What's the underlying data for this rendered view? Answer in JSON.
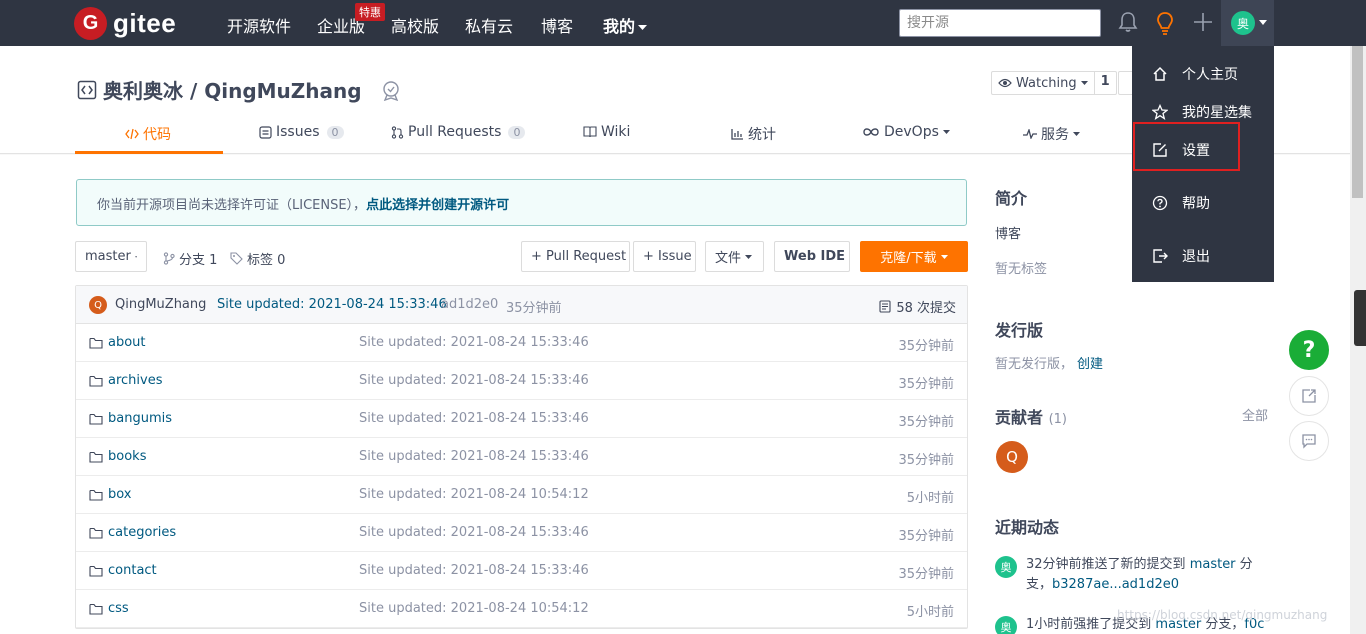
{
  "topnav": {
    "logo_letter": "G",
    "logo_text": "gitee",
    "items": [
      "开源软件",
      "企业版",
      "高校版",
      "私有云",
      "博客",
      "我的"
    ],
    "enterprise_badge": "特惠",
    "search_placeholder": "搜开源",
    "avatar_letter": "奥"
  },
  "repo": {
    "title": "奥利奥冰 / QingMuZhang",
    "watch_label": "Watching",
    "watch_count": "1",
    "tabs": [
      {
        "label": "代码",
        "count": ""
      },
      {
        "label": "Issues",
        "count": "0"
      },
      {
        "label": "Pull Requests",
        "count": "0"
      },
      {
        "label": "Wiki",
        "count": ""
      },
      {
        "label": "统计",
        "count": ""
      },
      {
        "label": "DevOps",
        "count": ""
      },
      {
        "label": "服务",
        "count": ""
      }
    ]
  },
  "license": {
    "text": "你当前开源项目尚未选择许可证（LICENSE），",
    "link": "点此选择并创建开源许可"
  },
  "toolbar": {
    "branch": "master",
    "branches": "分支 1",
    "tags": "标签 0",
    "pull_request": "+ Pull Request",
    "issue": "+ Issue",
    "files": "文件",
    "web_ide": "Web IDE",
    "clone": "克隆/下载"
  },
  "commit": {
    "avatar": "Q",
    "author": "QingMuZhang",
    "message": "Site updated: 2021-08-24 15:33:46",
    "hash": "ad1d2e0",
    "time": "35分钟前",
    "count": "58 次提交"
  },
  "files": [
    {
      "name": "about",
      "message": "Site updated: 2021-08-24 15:33:46",
      "time": "35分钟前"
    },
    {
      "name": "archives",
      "message": "Site updated: 2021-08-24 15:33:46",
      "time": "35分钟前"
    },
    {
      "name": "bangumis",
      "message": "Site updated: 2021-08-24 15:33:46",
      "time": "35分钟前"
    },
    {
      "name": "books",
      "message": "Site updated: 2021-08-24 15:33:46",
      "time": "35分钟前"
    },
    {
      "name": "box",
      "message": "Site updated: 2021-08-24 10:54:12",
      "time": "5小时前"
    },
    {
      "name": "categories",
      "message": "Site updated: 2021-08-24 15:33:46",
      "time": "35分钟前"
    },
    {
      "name": "contact",
      "message": "Site updated: 2021-08-24 15:33:46",
      "time": "35分钟前"
    },
    {
      "name": "css",
      "message": "Site updated: 2021-08-24 10:54:12",
      "time": "5小时前"
    }
  ],
  "sidebar": {
    "intro_title": "简介",
    "intro_text": "博客",
    "no_tags": "暂无标签",
    "release_title": "发行版",
    "release_text": "暂无发行版，",
    "release_link": "创建",
    "contrib_title": "贡献者",
    "contrib_count": "(1)",
    "contrib_all": "全部",
    "contrib_avatar": "Q",
    "activity_title": "近期动态",
    "activities": [
      {
        "avatar": "奥",
        "text1": "32分钟前推送了新的提交到 ",
        "link1": "master",
        "text2": " 分支，",
        "link2": "b3287ae...ad1d2e0"
      },
      {
        "avatar": "奥",
        "text1": "1小时前强推了提交到 ",
        "link1": "master",
        "text2": " 分支，",
        "link2": "f0c"
      }
    ]
  },
  "dropdown": {
    "items": [
      "个人主页",
      "我的星选集",
      "设置",
      "帮助",
      "退出"
    ]
  },
  "watermark": "https://blog.csdn.net/qingmuzhang",
  "colors": {
    "accent": "#fe7300",
    "nav_bg": "#2f3542",
    "link": "#005980",
    "highlight": "#e02020"
  }
}
